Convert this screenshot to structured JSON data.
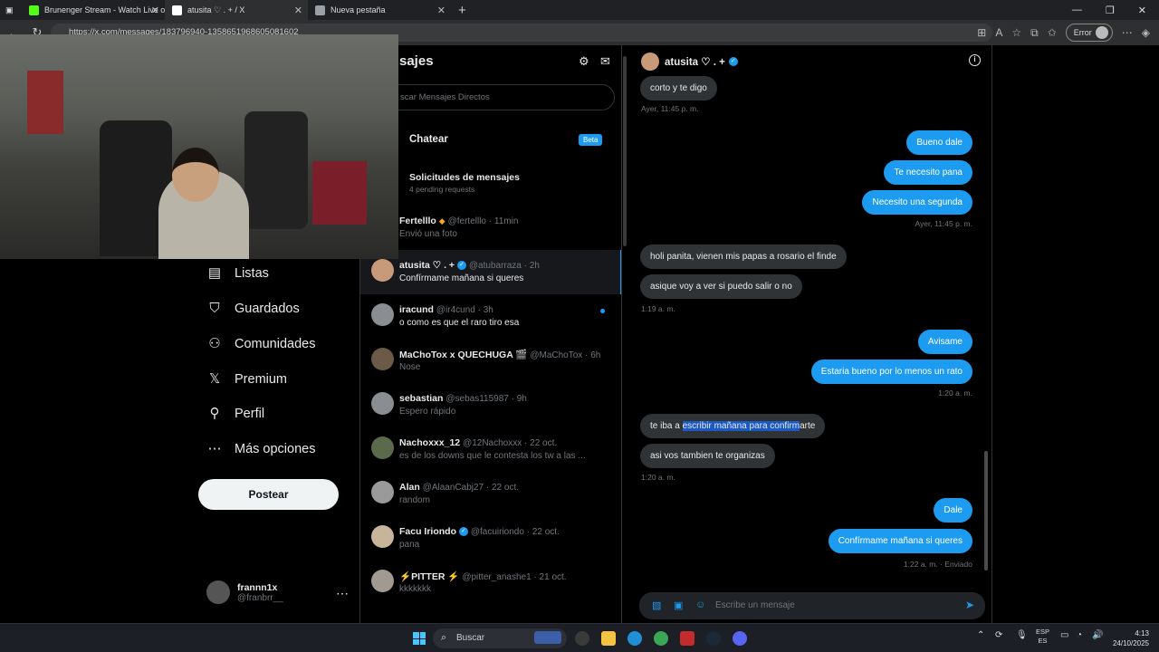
{
  "browser": {
    "tabs": [
      {
        "title": "Brunenger Stream - Watch Live o",
        "icon_color": "#53fc18",
        "icon": "kick-icon"
      },
      {
        "title": "atusita ♡ . + / X",
        "icon_color": "#ffffff",
        "icon": "x-icon"
      },
      {
        "title": "Nueva pestaña",
        "icon_color": "#9aa0a6",
        "icon": "page-icon"
      }
    ],
    "url": "https://x.com/messages/183796940-1358651968605081602",
    "error_label": "Error"
  },
  "sidebar": {
    "items": [
      {
        "label": "Listas",
        "icon": "list-icon",
        "glyph": "▤"
      },
      {
        "label": "Guardados",
        "icon": "bookmark-icon",
        "glyph": "⛉"
      },
      {
        "label": "Comunidades",
        "icon": "communities-icon",
        "glyph": "⚇"
      },
      {
        "label": "Premium",
        "icon": "x-logo-icon",
        "glyph": "𝕏"
      },
      {
        "label": "Perfil",
        "icon": "person-icon",
        "glyph": "⚲"
      },
      {
        "label": "Más opciones",
        "icon": "more-icon",
        "glyph": "⋯"
      }
    ],
    "post_label": "Postear",
    "account": {
      "name": "frannn1x",
      "handle": "@franbrr__"
    }
  },
  "messages_panel": {
    "title": "sajes",
    "search_placeholder": "scar Mensajes Directos",
    "chat_label": "Chatear",
    "beta_label": "Beta",
    "requests_title": "Solicitudes de mensajes",
    "requests_sub": "4 pending requests",
    "conversations": [
      {
        "name": "Fertelllo",
        "badge": "orange",
        "handle": "@fertelllo",
        "time": "11min",
        "preview": "Envió una foto",
        "unread": false,
        "selected": false,
        "avatar_color": "#1e1e1e"
      },
      {
        "name": "atusita ♡ . +",
        "badge": "blue",
        "handle": "@atubarraza",
        "time": "2h",
        "preview": "Confírmame mañana si queres",
        "unread": true,
        "selected": true,
        "avatar_color": "#c89a7a"
      },
      {
        "name": "iracund",
        "badge": "",
        "handle": "@ir4cund",
        "time": "3h",
        "preview": "o como es que el raro tiro esa",
        "unread": true,
        "selected": false,
        "avatar_color": "#8a8d91",
        "dot": true
      },
      {
        "name": "MaChoTox x QUECHUGA 🎬",
        "badge": "",
        "handle": "@MaChoTox",
        "time": "6h",
        "preview": "Nose",
        "unread": false,
        "selected": false,
        "avatar_color": "#6b5a48"
      },
      {
        "name": "sebastian",
        "badge": "",
        "handle": "@sebas115987",
        "time": "9h",
        "preview": "Espero rápido",
        "unread": false,
        "selected": false,
        "avatar_color": "#8a8d91"
      },
      {
        "name": "Nachoxxx_12",
        "badge": "",
        "handle": "@12Nachoxxx",
        "time": "22 oct.",
        "preview": "es de los downs que le contesta los tw a las ...",
        "unread": false,
        "selected": false,
        "avatar_color": "#5a6a4a"
      },
      {
        "name": "Alan",
        "badge": "",
        "handle": "@AlaanCabj27",
        "time": "22 oct.",
        "preview": "random",
        "unread": false,
        "selected": false,
        "avatar_color": "#9a9a9a"
      },
      {
        "name": "Facu Iriondo",
        "badge": "blue",
        "handle": "@facuiriondo",
        "time": "22 oct.",
        "preview": "pana",
        "unread": false,
        "selected": false,
        "avatar_color": "#c8b49a"
      },
      {
        "name": "⚡PITTER ⚡",
        "badge": "",
        "handle": "@pitter_anashe1",
        "time": "21 oct.",
        "preview": "kkkkkkk",
        "unread": false,
        "selected": false,
        "avatar_color": "#a09a90"
      }
    ]
  },
  "chat": {
    "name": "atusita ♡ . +",
    "composer_placeholder": "Escribe un mensaje",
    "messages": [
      {
        "dir": "in",
        "text": "corto y te digo"
      },
      {
        "dir": "ts",
        "side": "l",
        "text": "Ayer, 11:45 p. m."
      },
      {
        "dir": "out",
        "text": "Bueno dale"
      },
      {
        "dir": "out",
        "text": "Te necesito pana"
      },
      {
        "dir": "out",
        "text": "Necesito una segunda"
      },
      {
        "dir": "ts",
        "side": "r",
        "text": "Ayer, 11:45 p. m."
      },
      {
        "dir": "in",
        "text": "holi panita, vienen mis papas a rosario el finde"
      },
      {
        "dir": "in",
        "text": "asique voy a ver si puedo salir o no"
      },
      {
        "dir": "ts",
        "side": "l",
        "text": "1:19 a. m."
      },
      {
        "dir": "out",
        "text": "Avisame"
      },
      {
        "dir": "out",
        "text": "Estaria bueno por lo menos un rato"
      },
      {
        "dir": "ts",
        "side": "r",
        "text": "1:20 a. m."
      },
      {
        "dir": "in",
        "text_pre": "te iba a ",
        "text_hl": "escribir mañana para confirm",
        "text_post": "arte"
      },
      {
        "dir": "in",
        "text": "asi vos tambien te organizas"
      },
      {
        "dir": "ts",
        "side": "l",
        "text": "1:20 a. m."
      },
      {
        "dir": "out",
        "text": "Dale"
      },
      {
        "dir": "out",
        "text": "Confírmame mañana si queres"
      },
      {
        "dir": "ts",
        "side": "r",
        "text": "1:22 a. m. · Enviado"
      }
    ]
  },
  "taskbar": {
    "search_label": "Buscar",
    "lang1": "ESP",
    "lang2": "ES",
    "time": "4:13",
    "date": "24/10/2025"
  }
}
